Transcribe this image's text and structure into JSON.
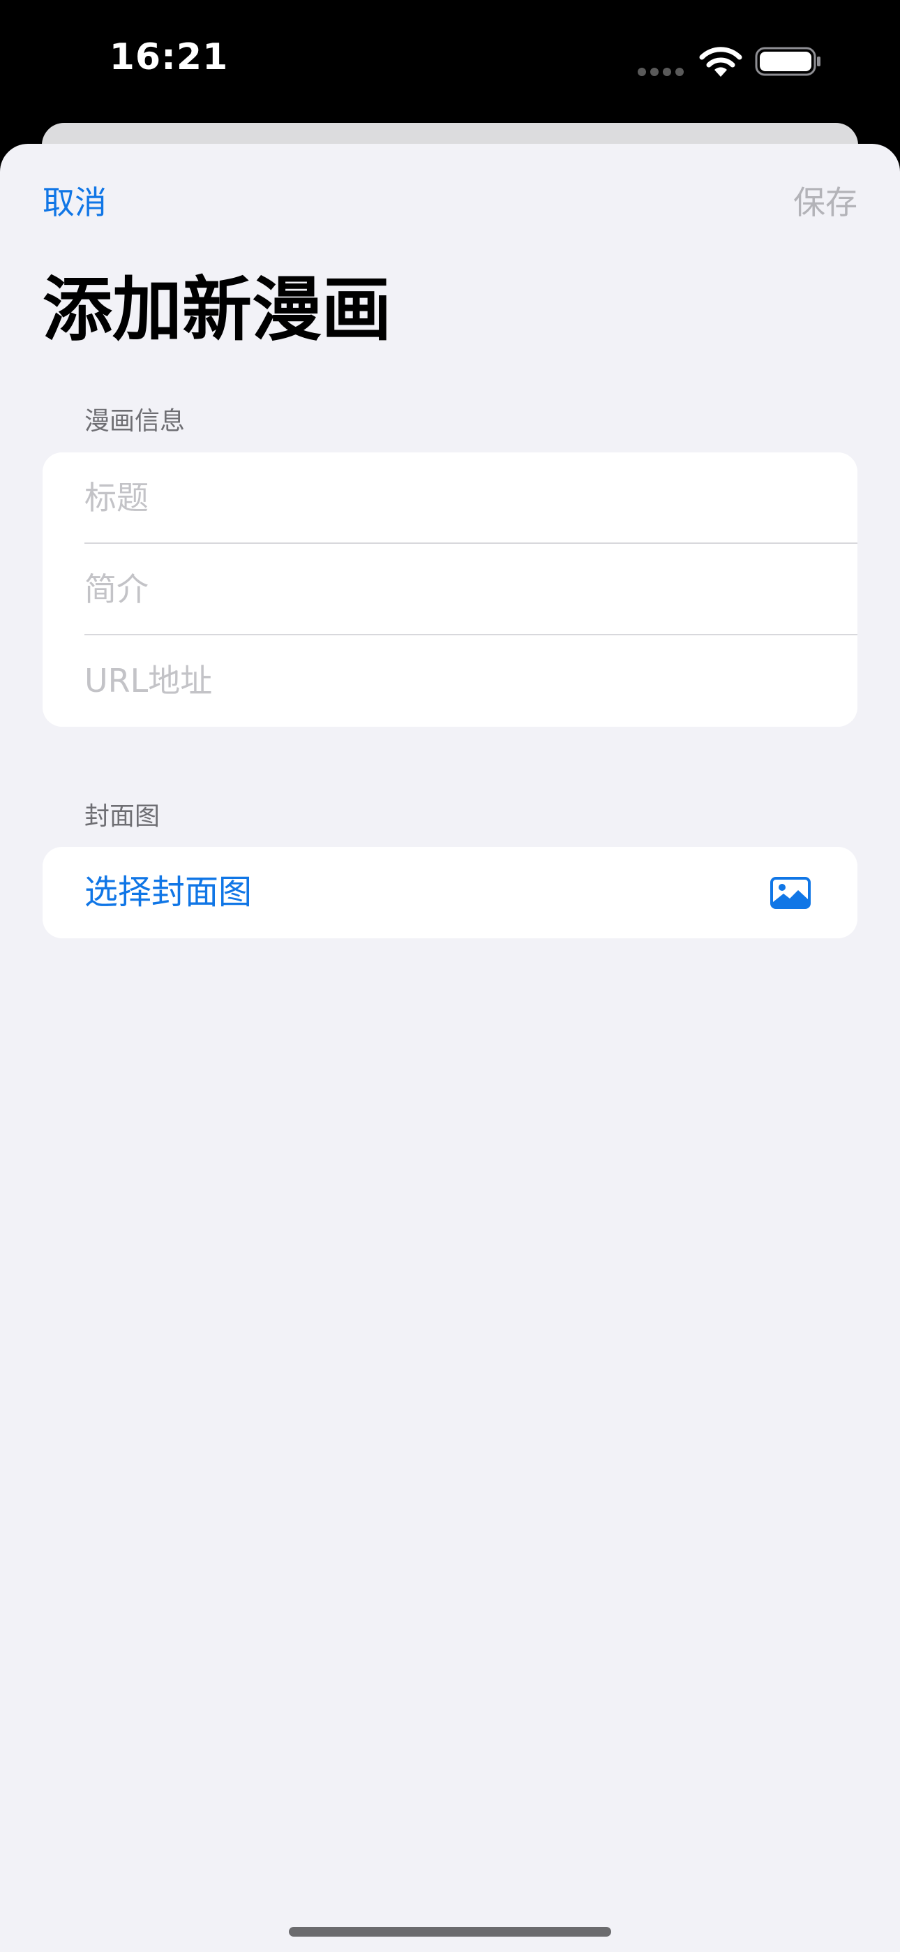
{
  "status_bar": {
    "time": "16:21"
  },
  "nav": {
    "cancel_label": "取消",
    "save_label": "保存"
  },
  "title": "添加新漫画",
  "sections": {
    "info": {
      "header": "漫画信息",
      "fields": [
        {
          "placeholder": "标题"
        },
        {
          "placeholder": "简介"
        },
        {
          "placeholder": "URL地址"
        }
      ]
    },
    "cover": {
      "header": "封面图",
      "button_label": "选择封面图",
      "icon": "photo-icon"
    }
  },
  "colors": {
    "accent": "#1076e6",
    "disabled": "#b3b3b8",
    "background": "#f2f2f7",
    "placeholder": "#c3c3c7"
  }
}
